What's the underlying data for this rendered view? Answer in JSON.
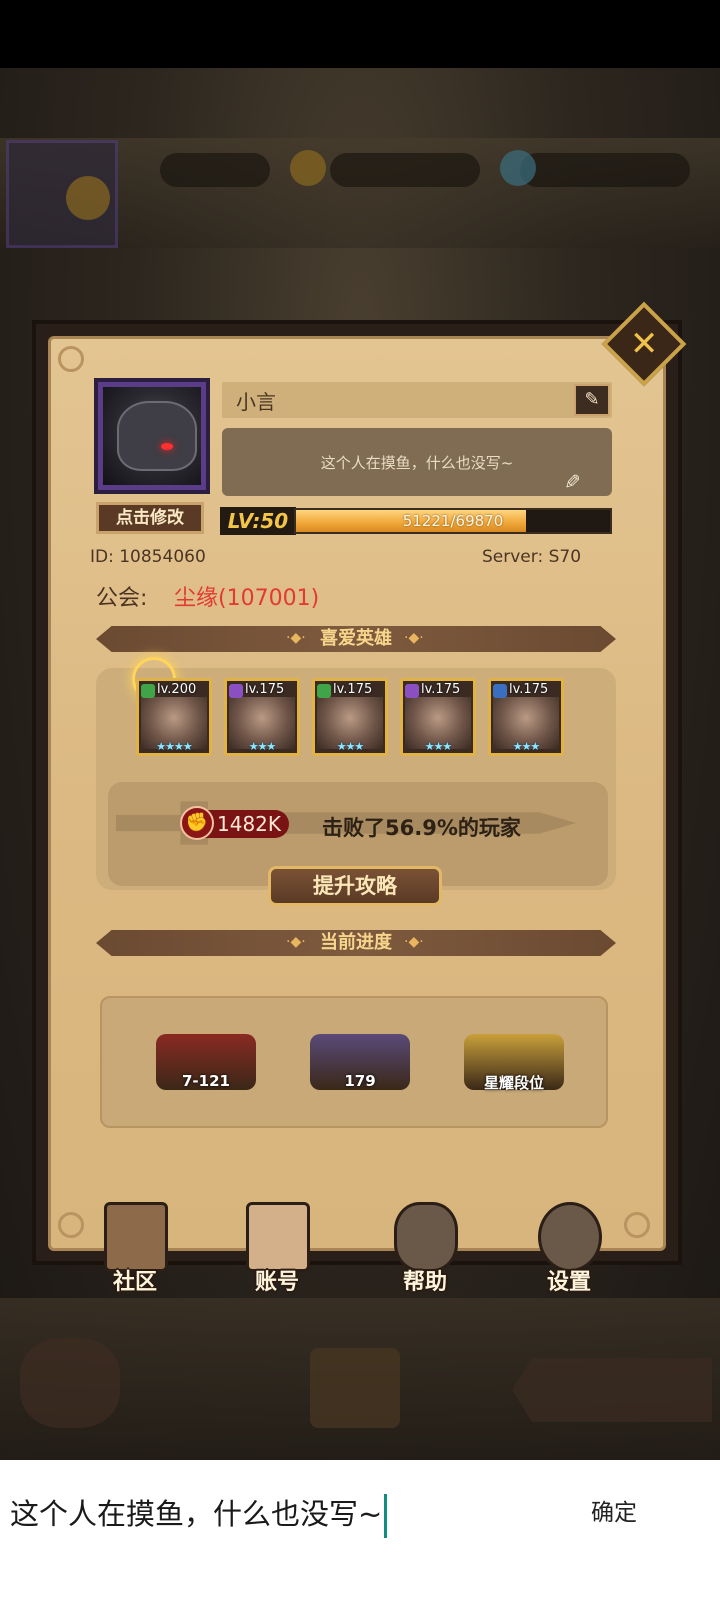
{
  "profile": {
    "name": "小言",
    "signature": "这个人在摸鱼，什么也没写~",
    "edit_avatar_label": "点击修改",
    "level_label": "LV:50",
    "xp_text": "51221/69870",
    "xp_fraction": 0.733,
    "id_text": "ID:  10854060",
    "server_text": "Server:  S70",
    "guild_label": "公会:",
    "guild_value": "尘缘(107001)"
  },
  "sections": {
    "favorite_heroes": "喜爱英雄",
    "current_progress": "当前进度"
  },
  "heroes": [
    {
      "level": "lv.200",
      "class_color": "#3fa548",
      "stars": "★★★★"
    },
    {
      "level": "lv.175",
      "class_color": "#8a4fc0",
      "stars": "★★★"
    },
    {
      "level": "lv.175",
      "class_color": "#3fa548",
      "stars": "★★★"
    },
    {
      "level": "lv.175",
      "class_color": "#8a4fc0",
      "stars": "★★★"
    },
    {
      "level": "lv.175",
      "class_color": "#3a6ec0",
      "stars": "★★★"
    }
  ],
  "power": {
    "value": "1482K",
    "defeat_text": "击败了56.9%的玩家",
    "improve_label": "提升攻略"
  },
  "progress": [
    {
      "label": "7-121",
      "color": "#8a2a22"
    },
    {
      "label": "179",
      "color": "#5a4a78"
    },
    {
      "label": "星耀段位",
      "color": "#c9a03a"
    }
  ],
  "nav": [
    {
      "label": "社区",
      "icon": "castle-icon",
      "color": "#8c6a4a"
    },
    {
      "label": "账号",
      "icon": "account-card-icon",
      "color": "#d4b08a"
    },
    {
      "label": "帮助",
      "icon": "chat-bubble-icon",
      "color": "#6a5848"
    },
    {
      "label": "设置",
      "icon": "gear-icon",
      "color": "#6a5848"
    }
  ],
  "input": {
    "value": "这个人在摸鱼，什么也没写~",
    "confirm_label": "确定"
  },
  "colors": {
    "accent_gold": "#f4c648",
    "guild_red": "#e23a30",
    "caret": "#0f8f7f"
  }
}
